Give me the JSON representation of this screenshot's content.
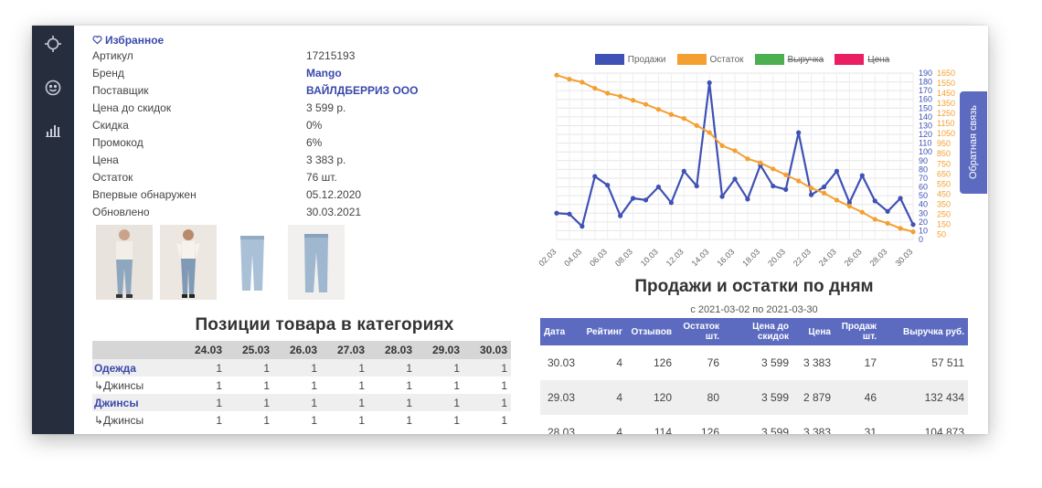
{
  "sidebar": {
    "icons": [
      "crosshair-icon",
      "smile-icon",
      "bar-chart-icon"
    ]
  },
  "product": {
    "favorite_label": "Избранное",
    "fields": [
      {
        "key": "Артикул",
        "value": "17215193",
        "link": false
      },
      {
        "key": "Бренд",
        "value": "Mango",
        "link": true
      },
      {
        "key": "Поставщик",
        "value": "ВАЙЛДБЕРРИЗ ООО",
        "link": true
      },
      {
        "key": "Цена до скидок",
        "value": "3 599 р.",
        "link": false
      },
      {
        "key": "Скидка",
        "value": "0%",
        "link": false
      },
      {
        "key": "Промокод",
        "value": "6%",
        "link": false
      },
      {
        "key": "Цена",
        "value": "3 383 р.",
        "link": false
      },
      {
        "key": "Остаток",
        "value": "76 шт.",
        "link": false
      },
      {
        "key": "Впервые обнаружен",
        "value": "05.12.2020",
        "link": false
      },
      {
        "key": "Обновлено",
        "value": "30.03.2021",
        "link": false
      }
    ]
  },
  "categories": {
    "title": "Позиции товара в категориях",
    "dates": [
      "24.03",
      "25.03",
      "26.03",
      "27.03",
      "28.03",
      "29.03",
      "30.03"
    ],
    "rows": [
      {
        "label": "Одежда",
        "link": true,
        "values": [
          "1",
          "1",
          "1",
          "1",
          "1",
          "1",
          "1"
        ]
      },
      {
        "label": "↳Джинсы",
        "link": false,
        "values": [
          "1",
          "1",
          "1",
          "1",
          "1",
          "1",
          "1"
        ]
      },
      {
        "label": "Джинсы",
        "link": true,
        "values": [
          "1",
          "1",
          "1",
          "1",
          "1",
          "1",
          "1"
        ]
      },
      {
        "label": "↳Джинсы",
        "link": false,
        "values": [
          "1",
          "1",
          "1",
          "1",
          "1",
          "1",
          "1"
        ]
      }
    ]
  },
  "feedback_label": "Обратная связь",
  "chart_data": {
    "type": "line",
    "title": "",
    "legend": [
      {
        "name": "Продажи",
        "color": "#3f51b5",
        "struck": false
      },
      {
        "name": "Остаток",
        "color": "#f4a030",
        "struck": false
      },
      {
        "name": "Выручка",
        "color": "#4caf50",
        "struck": true
      },
      {
        "name": "Цена",
        "color": "#e91e63",
        "struck": true
      }
    ],
    "x_tick_labels": [
      "02.03",
      "04.03",
      "06.03",
      "08.03",
      "10.03",
      "12.03",
      "14.03",
      "16.03",
      "18.03",
      "20.03",
      "22.03",
      "24.03",
      "26.03",
      "28.03",
      "30.03"
    ],
    "x": [
      "02.03",
      "03.03",
      "04.03",
      "05.03",
      "06.03",
      "07.03",
      "08.03",
      "09.03",
      "10.03",
      "11.03",
      "12.03",
      "13.03",
      "14.03",
      "15.03",
      "16.03",
      "17.03",
      "18.03",
      "19.03",
      "20.03",
      "21.03",
      "22.03",
      "23.03",
      "24.03",
      "25.03",
      "26.03",
      "27.03",
      "28.03",
      "29.03",
      "30.03"
    ],
    "y_left_ticks": [
      "190",
      "180",
      "170",
      "160",
      "150",
      "140",
      "130",
      "120",
      "110",
      "100",
      "90",
      "80",
      "70",
      "60",
      "50",
      "40",
      "30",
      "20",
      "10",
      "0"
    ],
    "y_right_ticks": [
      "1650",
      "1550",
      "1450",
      "1350",
      "1250",
      "1150",
      "1050",
      "950",
      "850",
      "750",
      "650",
      "550",
      "450",
      "350",
      "250",
      "150",
      "50"
    ],
    "ylim_left": [
      0,
      190
    ],
    "ylim_right": [
      0,
      1650
    ],
    "grid": true,
    "series": [
      {
        "name": "Продажи",
        "axis": "left",
        "color": "#3f51b5",
        "values": [
          30,
          29,
          15,
          72,
          62,
          27,
          47,
          45,
          60,
          42,
          78,
          61,
          179,
          49,
          69,
          46,
          85,
          61,
          57,
          122,
          51,
          60,
          78,
          42,
          73,
          44,
          32,
          47,
          17
        ]
      },
      {
        "name": "Остаток",
        "axis": "right",
        "color": "#f4a030",
        "values": [
          1630,
          1590,
          1560,
          1500,
          1450,
          1420,
          1380,
          1340,
          1290,
          1240,
          1200,
          1130,
          1060,
          930,
          880,
          800,
          760,
          700,
          640,
          580,
          510,
          460,
          390,
          330,
          270,
          200,
          160,
          110,
          76
        ]
      }
    ]
  },
  "sales": {
    "title": "Продажи и остатки по дням",
    "subtitle": "с 2021-03-02 по 2021-03-30",
    "headers": [
      "Дата",
      "Рейтинг",
      "Отзывов",
      "Остаток шт.",
      "Цена до скидок",
      "Цена",
      "Продаж шт.",
      "Выручка руб."
    ],
    "rows": [
      [
        "30.03",
        "4",
        "126",
        "76",
        "3 599",
        "3 383",
        "17",
        "57 511"
      ],
      [
        "29.03",
        "4",
        "120",
        "80",
        "3 599",
        "2 879",
        "46",
        "132 434"
      ],
      [
        "28.03",
        "4",
        "114",
        "126",
        "3 599",
        "3 383",
        "31",
        "104 873"
      ]
    ]
  }
}
